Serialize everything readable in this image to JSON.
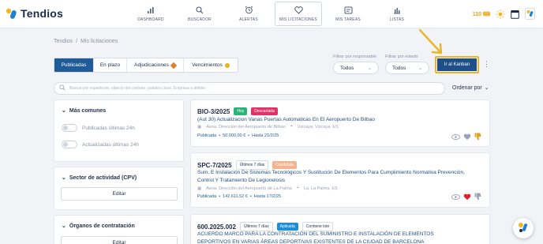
{
  "app": {
    "name": "Tendios",
    "brand_colors": {
      "primary": "#1e5b97",
      "accent_yellow": "#e8b626",
      "logo_blue": "#1f7fd0",
      "logo_yellow": "#f2b71f"
    }
  },
  "nav": {
    "items": [
      {
        "label": "DASHBOARD",
        "icon": "bar-chart-icon"
      },
      {
        "label": "BUSCADOR",
        "icon": "search-icon"
      },
      {
        "label": "ALERTAS",
        "icon": "alarm-clock-icon"
      },
      {
        "label": "MIS LICITACIONES",
        "icon": "heart-icon",
        "active": true
      },
      {
        "label": "MIS TAREAS",
        "icon": "task-board-icon"
      },
      {
        "label": "LISTAS",
        "icon": "list-chart-icon"
      }
    ]
  },
  "toolbar": {
    "coins": "110",
    "icons": [
      "coins-icon",
      "sun-icon",
      "calendar-icon",
      "user-avatar-icon"
    ]
  },
  "breadcrumb": {
    "root": "Tendios",
    "separator": "/",
    "current": "Mis licitaciones"
  },
  "tabs": [
    {
      "label": "Publicadas",
      "active": true
    },
    {
      "label": "En plazo"
    },
    {
      "label": "Adjudicaciones"
    },
    {
      "label": "Vencimientos"
    }
  ],
  "filters": {
    "responsable_label": "Filtrar por responsable",
    "responsable_value": "Todos",
    "estado_label": "Filtrar por estado",
    "estado_value": "Todos",
    "kanban_label": "Ir al Kanban"
  },
  "search": {
    "placeholder": "Buscar por expediente, objecto del contrato, palabra clave, Empresa o ámbito",
    "sort_label": "Ordenar por"
  },
  "sidebar": {
    "common": {
      "title": "Más comunes",
      "toggles": [
        "Publicadas últimas 24h",
        "Actualizadas últimas 24h"
      ]
    },
    "cpv": {
      "title": "Sector de actividad (CPV)",
      "button": "Editar"
    },
    "organos": {
      "title": "Órganos de contratación",
      "button": "Editar"
    }
  },
  "results": [
    {
      "ref": "BIO-3/2025",
      "badges": [
        {
          "label": "Hoy",
          "style": "hoy"
        },
        {
          "label": "Descartada",
          "style": "descartada"
        }
      ],
      "title": "(Aut 30) Actualizacion Varias Puertas Automaticas En El Aeropuerto De Bilbao",
      "organ": "Aena. Dirección del Aeropuerto de Bilbao",
      "location": "Vizcaya, Vizcaya, ES",
      "status": "Publicada",
      "amount": "50.000,00 €",
      "deadline": "Hasta 21/2/25"
    },
    {
      "ref": "SPC-7/2025",
      "badges": [
        {
          "label": "Últimos 7 días",
          "style": "ult"
        },
        {
          "label": "Candidata",
          "style": "candidata"
        }
      ],
      "title": "Sum. E Instalación De Sistemas Tecnológicos Y Sustitución De Elementos Para Cumplimiento Normativa Prevención, Control Y Tratamiento De Legionelosis",
      "organ": "Aena. Dirección del Aeropuerto de La Palma",
      "location": "La, La Palma, ES",
      "status": "Publicada",
      "amount": "142.611,52 €",
      "deadline": "Hasta 17/2/25"
    },
    {
      "ref": "600.2025.002",
      "badges": [
        {
          "label": "Últimos 7 días",
          "style": "ult"
        },
        {
          "label": "Aplicada",
          "style": "aplicada"
        },
        {
          "label": "Contiene lote",
          "style": "lote"
        }
      ],
      "title": "ACUERDO MARCO PARA LA CONTRATACIÓN DEL SUMINISTRO E INSTALACIÓN DE ELEMENTOS DEPORTIVOS EN VARIAS ÁREAS DEPORTIVAS EXISTENTES DE LA CIUDAD DE BARCELONA"
    }
  ]
}
